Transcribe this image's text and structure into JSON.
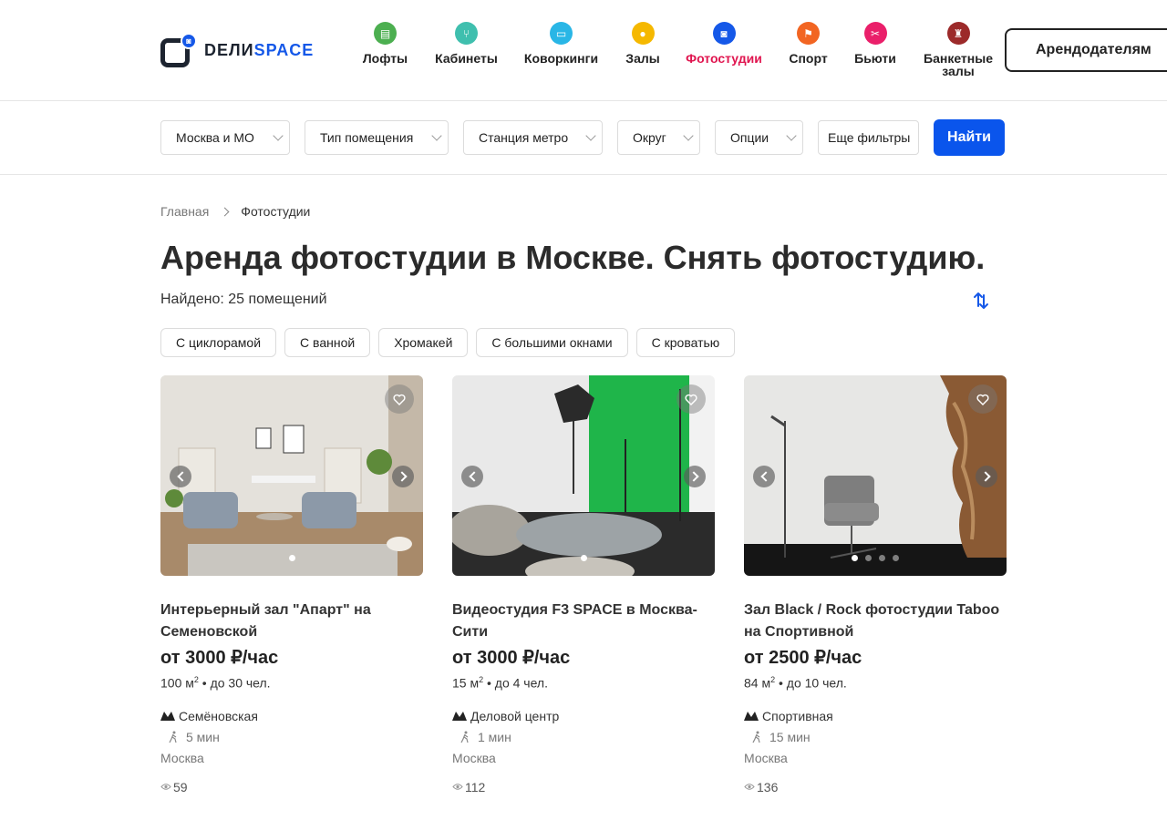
{
  "header": {
    "logo": {
      "part1": "DEЛИ",
      "part2": "SPACE"
    },
    "nav": [
      {
        "label": "Лофты",
        "icon": "loft-icon",
        "color": "#4caf50"
      },
      {
        "label": "Кабинеты",
        "icon": "office-icon",
        "color": "#3fbfae"
      },
      {
        "label": "Коворкинги",
        "icon": "coworking-icon",
        "color": "#29b6e6"
      },
      {
        "label": "Залы",
        "icon": "hall-icon",
        "color": "#f5b800"
      },
      {
        "label": "Фотостудии",
        "icon": "camera-icon",
        "color": "#1558e8"
      },
      {
        "label": "Спорт",
        "icon": "running-icon",
        "color": "#f26522"
      },
      {
        "label": "Бьюти",
        "icon": "beauty-icon",
        "color": "#ea1f6a"
      },
      {
        "label": "Банкетные залы",
        "label_line1": "Банкетные",
        "label_line2": "залы",
        "icon": "banquet-icon",
        "color": "#9c2a2a"
      }
    ],
    "active_nav": "Фотостудии",
    "owners_button": "Арендодателям"
  },
  "filters": {
    "region": "Москва и МО",
    "room_type": "Тип помещения",
    "metro": "Станция метро",
    "district": "Округ",
    "options": "Опции",
    "more": "Еще фильтры",
    "find_button": "Найти"
  },
  "breadcrumb": {
    "home": "Главная",
    "current": "Фотостудии"
  },
  "page": {
    "title": "Аренда фотостудии в Москве. Снять фотостудию.",
    "found": "Найдено: 25 помещений"
  },
  "tags": [
    "С циклорамой",
    "С ванной",
    "Хромакей",
    "С большими окнами",
    "С кроватью"
  ],
  "listings": [
    {
      "name": "Интерьерный зал \"Апарт\" на Семеновской",
      "price": "от 3000 ₽/час",
      "area": "100 м",
      "capacity": "• до 30 чел.",
      "metro": "Семёновская",
      "walk": "5 мин",
      "city": "Москва",
      "views": "59",
      "slides": 1,
      "active_slide": 0
    },
    {
      "name": "Видеостудия F3 SPACE в Москва-Сити",
      "price": "от 3000 ₽/час",
      "area": "15 м",
      "capacity": "• до 4 чел.",
      "metro": "Деловой центр",
      "walk": "1 мин",
      "city": "Москва",
      "views": "112",
      "slides": 1,
      "active_slide": 0
    },
    {
      "name": "Зал Black / Rock фотостудии Taboo на Спортивной",
      "price": "от 2500 ₽/час",
      "area": "84 м",
      "capacity": "• до 10 чел.",
      "metro": "Спортивная",
      "walk": "15 мин",
      "city": "Москва",
      "views": "136",
      "slides": 4,
      "active_slide": 0
    }
  ],
  "colors": {
    "accent": "#0a55ec",
    "active_nav": "#e0154f",
    "text": "#222222"
  }
}
